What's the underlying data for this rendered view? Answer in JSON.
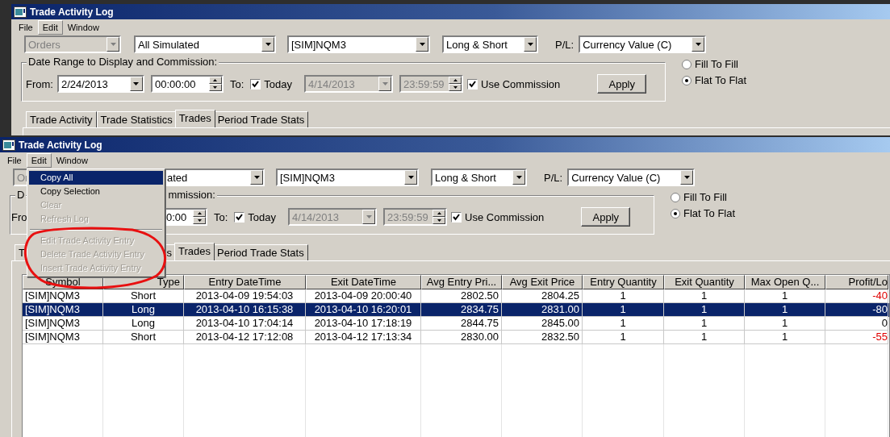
{
  "windows": [
    {
      "title": "Trade Activity Log",
      "menu": [
        {
          "label": "File",
          "selected": false
        },
        {
          "label": "Edit",
          "selected": true
        },
        {
          "label": "Window",
          "selected": false
        }
      ],
      "filters": [
        {
          "value": "Orders",
          "disabled": true
        },
        {
          "value": "All Simulated",
          "disabled": false
        },
        {
          "value": "[SIM]NQM3",
          "disabled": false
        },
        {
          "value": "Long & Short",
          "disabled": false
        }
      ],
      "pl_label": "P/L:",
      "pl_value": "Currency Value (C)",
      "date_group": {
        "title": [
          "Date Range to Display and Commission:"
        ],
        "from_label": "From:",
        "from_date": "2/24/2013",
        "from_time": "00:00:00",
        "to_label": "To:",
        "today": {
          "label": "Today",
          "checked": true
        },
        "to_date": "4/14/2013",
        "to_time": "23:59:59",
        "commission": {
          "label": "Use Commission",
          "checked": true
        },
        "apply": "Apply"
      },
      "modes": [
        {
          "label": "Fill To Fill",
          "selected": false
        },
        {
          "label": "Flat To Flat",
          "selected": true
        }
      ],
      "tabs": [
        {
          "label": "Trade Activity",
          "selected": false
        },
        {
          "label": "Trade Statistics",
          "selected": false
        },
        {
          "label": "Trades",
          "selected": true
        },
        {
          "label": "Period Trade Stats",
          "selected": false
        }
      ]
    },
    {
      "title": "Trade Activity Log",
      "menu": [
        {
          "label": "File",
          "selected": false
        },
        {
          "label": "Edit",
          "selected": true
        },
        {
          "label": "Window",
          "selected": false
        }
      ],
      "filters": [
        {
          "value": "Or",
          "disabled": true
        },
        {
          "value": "ated",
          "disabled": false
        },
        {
          "value": "[SIM]NQM3",
          "disabled": false
        },
        {
          "value": "Long & Short",
          "disabled": false
        }
      ],
      "pl_label": "P/L:",
      "pl_value": "Currency Value (C)",
      "date_group": {
        "title": [
          "D",
          "mmission:"
        ],
        "from_label": "Fro",
        "from_time": "0:00",
        "to_label": "To:",
        "today": {
          "label": "Today",
          "checked": true
        },
        "to_date": "4/14/2013",
        "to_time": "23:59:59",
        "commission": {
          "label": "Use Commission",
          "checked": true
        },
        "apply": "Apply"
      },
      "modes": [
        {
          "label": "Fill To Fill",
          "selected": false
        },
        {
          "label": "Flat To Flat",
          "selected": true
        }
      ],
      "tabs": [
        {
          "label": "T",
          "selected": false
        },
        {
          "label": "s",
          "selected": false
        },
        {
          "label": "Trades",
          "selected": true
        },
        {
          "label": "Period Trade Stats",
          "selected": false
        }
      ],
      "table": {
        "columns": [
          "Symbol",
          "Type",
          "Entry DateTime",
          "Exit DateTime",
          "Avg Entry Pri...",
          "Avg Exit Price",
          "Entry Quantity",
          "Exit Quantity",
          "Max Open Q...",
          "Profit/Lo"
        ],
        "rows": [
          {
            "selected": false,
            "negative": true,
            "cells": [
              "[SIM]NQM3",
              "Short",
              "2013-04-09 19:54:03",
              "2013-04-09 20:00:40",
              "2802.50",
              "2804.25",
              "1",
              "1",
              "1",
              "-40"
            ]
          },
          {
            "selected": true,
            "negative": true,
            "cells": [
              "[SIM]NQM3",
              "Long",
              "2013-04-10 16:15:38",
              "2013-04-10 16:20:01",
              "2834.75",
              "2831.00",
              "1",
              "1",
              "1",
              "-80"
            ]
          },
          {
            "selected": false,
            "negative": false,
            "cells": [
              "[SIM]NQM3",
              "Long",
              "2013-04-10 17:04:14",
              "2013-04-10 17:18:19",
              "2844.75",
              "2845.00",
              "1",
              "1",
              "1",
              "0"
            ]
          },
          {
            "selected": false,
            "negative": true,
            "cells": [
              "[SIM]NQM3",
              "Short",
              "2013-04-12 17:12:08",
              "2013-04-12 17:13:34",
              "2830.00",
              "2832.50",
              "1",
              "1",
              "1",
              "-55"
            ]
          }
        ]
      },
      "edit_menu": [
        {
          "label": "Copy All",
          "selected": true,
          "disabled": false
        },
        {
          "label": "Copy Selection",
          "selected": false,
          "disabled": false
        },
        {
          "label": "Clear",
          "selected": false,
          "disabled": true
        },
        {
          "label": "Refresh Log",
          "selected": false,
          "disabled": true,
          "separator_after": true
        },
        {
          "label": "Edit Trade Activity Entry",
          "selected": false,
          "disabled": true
        },
        {
          "label": "Delete Trade Activity Entry",
          "selected": false,
          "disabled": true
        },
        {
          "label": "Insert Trade Activity Entry",
          "selected": false,
          "disabled": true
        }
      ]
    }
  ]
}
